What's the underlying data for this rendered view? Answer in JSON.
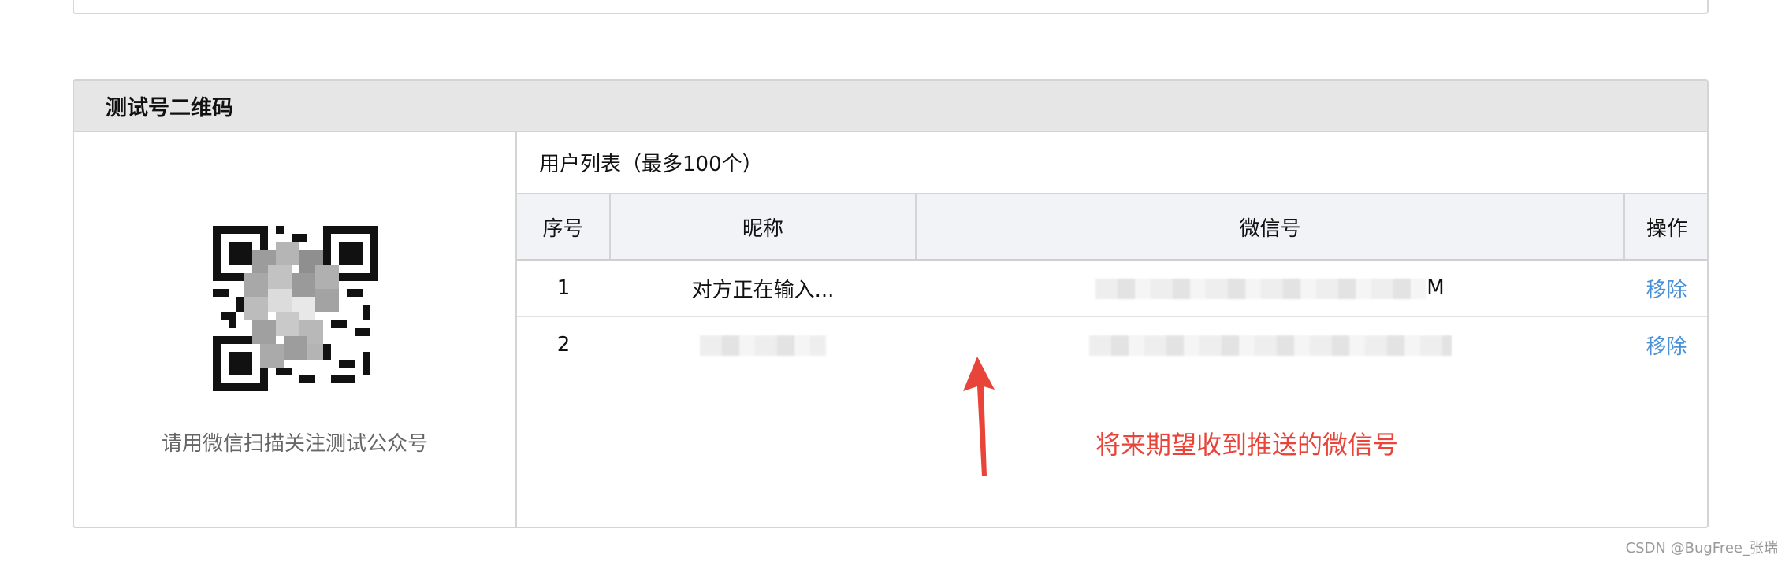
{
  "panel": {
    "title": "测试号二维码",
    "qr_caption": "请用微信扫描关注测试公众号"
  },
  "user_list": {
    "title": "用户列表（最多100个）",
    "columns": [
      "序号",
      "昵称",
      "微信号",
      "操作"
    ],
    "rows": [
      {
        "index": "1",
        "nickname": "对方正在输入...",
        "wechat_id_visible_tail": "M",
        "action": "移除"
      },
      {
        "index": "2",
        "nickname": "",
        "action": "移除"
      }
    ]
  },
  "annotation": "将来期望收到推送的微信号",
  "watermark": "CSDN @BugFree_张瑞",
  "colors": {
    "annotation": "#e8443a",
    "link": "#4a90d9",
    "header_bg": "#e6e6e6"
  }
}
